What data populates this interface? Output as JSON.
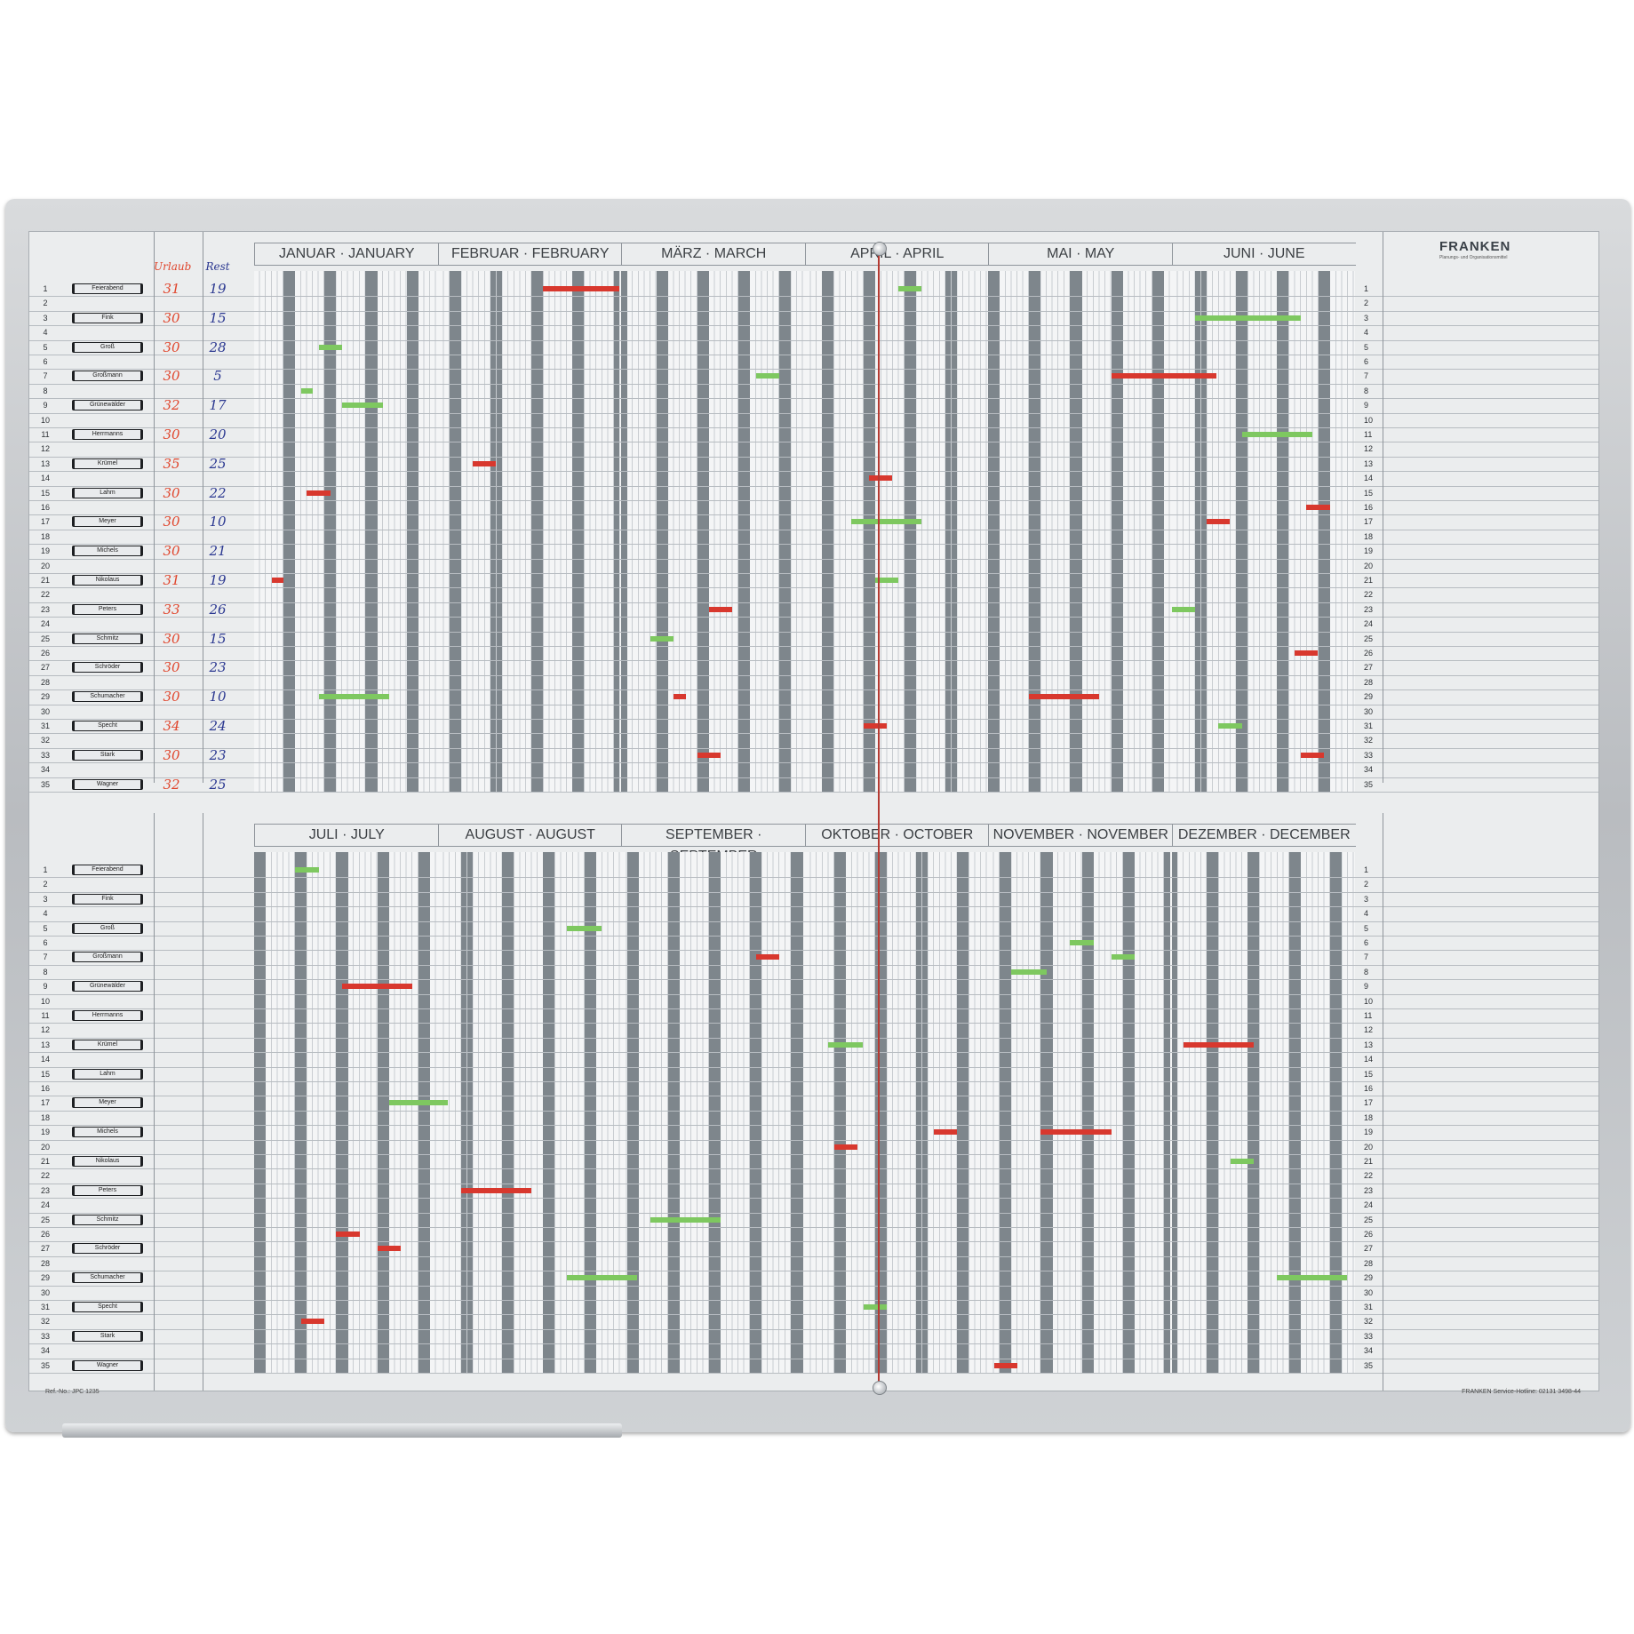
{
  "brand": {
    "name": "FRANKEN",
    "tagline": "Planungs- und Organisationsmittel"
  },
  "header": {
    "vacation_label": "Urlaub",
    "remaining_label": "Rest"
  },
  "months_top": [
    "JANUAR · JANUARY",
    "FEBRUAR · FEBRUARY",
    "MÄRZ · MARCH",
    "APRIL · APRIL",
    "MAI · MAY",
    "JUNI · JUNE"
  ],
  "months_bottom": [
    "JULI · JULY",
    "AUGUST · AUGUST",
    "SEPTEMBER · SEPTEMBER",
    "OKTOBER · OCTOBER",
    "NOVEMBER · NOVEMBER",
    "DEZEMBER · DECEMBER"
  ],
  "employees": [
    {
      "row": 1,
      "name": "Feierabend",
      "urlaub": "31",
      "rest": "19"
    },
    {
      "row": 3,
      "name": "Fink",
      "urlaub": "30",
      "rest": "15"
    },
    {
      "row": 5,
      "name": "Groß",
      "urlaub": "30",
      "rest": "28"
    },
    {
      "row": 7,
      "name": "Großmann",
      "urlaub": "30",
      "rest": "5"
    },
    {
      "row": 9,
      "name": "Grünewälder",
      "urlaub": "32",
      "rest": "17"
    },
    {
      "row": 11,
      "name": "Herrmanns",
      "urlaub": "30",
      "rest": "20"
    },
    {
      "row": 13,
      "name": "Krümel",
      "urlaub": "35",
      "rest": "25"
    },
    {
      "row": 15,
      "name": "Lahm",
      "urlaub": "30",
      "rest": "22"
    },
    {
      "row": 17,
      "name": "Meyer",
      "urlaub": "30",
      "rest": "10"
    },
    {
      "row": 19,
      "name": "Michels",
      "urlaub": "30",
      "rest": "21"
    },
    {
      "row": 21,
      "name": "Nikolaus",
      "urlaub": "31",
      "rest": "19"
    },
    {
      "row": 23,
      "name": "Peters",
      "urlaub": "33",
      "rest": "26"
    },
    {
      "row": 25,
      "name": "Schmitz",
      "urlaub": "30",
      "rest": "15"
    },
    {
      "row": 27,
      "name": "Schröder",
      "urlaub": "30",
      "rest": "23"
    },
    {
      "row": 29,
      "name": "Schumacher",
      "urlaub": "30",
      "rest": "10"
    },
    {
      "row": 31,
      "name": "Specht",
      "urlaub": "34",
      "rest": "24"
    },
    {
      "row": 33,
      "name": "Stark",
      "urlaub": "30",
      "rest": "23"
    },
    {
      "row": 35,
      "name": "Wagner",
      "urlaub": "32",
      "rest": "25"
    }
  ],
  "row_numbers": [
    "1",
    "2",
    "3",
    "4",
    "5",
    "6",
    "7",
    "8",
    "9",
    "10",
    "11",
    "12",
    "13",
    "14",
    "15",
    "16",
    "17",
    "18",
    "19",
    "20",
    "21",
    "22",
    "23",
    "24",
    "25",
    "26",
    "27",
    "28",
    "29",
    "30",
    "31",
    "32",
    "33",
    "34",
    "35"
  ],
  "footer": {
    "ref": "Ref.-No.: JPC 1235",
    "hotline": "FRANKEN Service-Hotline: 02131 3498-44"
  },
  "colors": {
    "green": "#7ec860",
    "red": "#d8382e",
    "stripe": "#7e868c",
    "vacation_ink": "#e0452c",
    "rest_ink": "#2a3790"
  }
}
